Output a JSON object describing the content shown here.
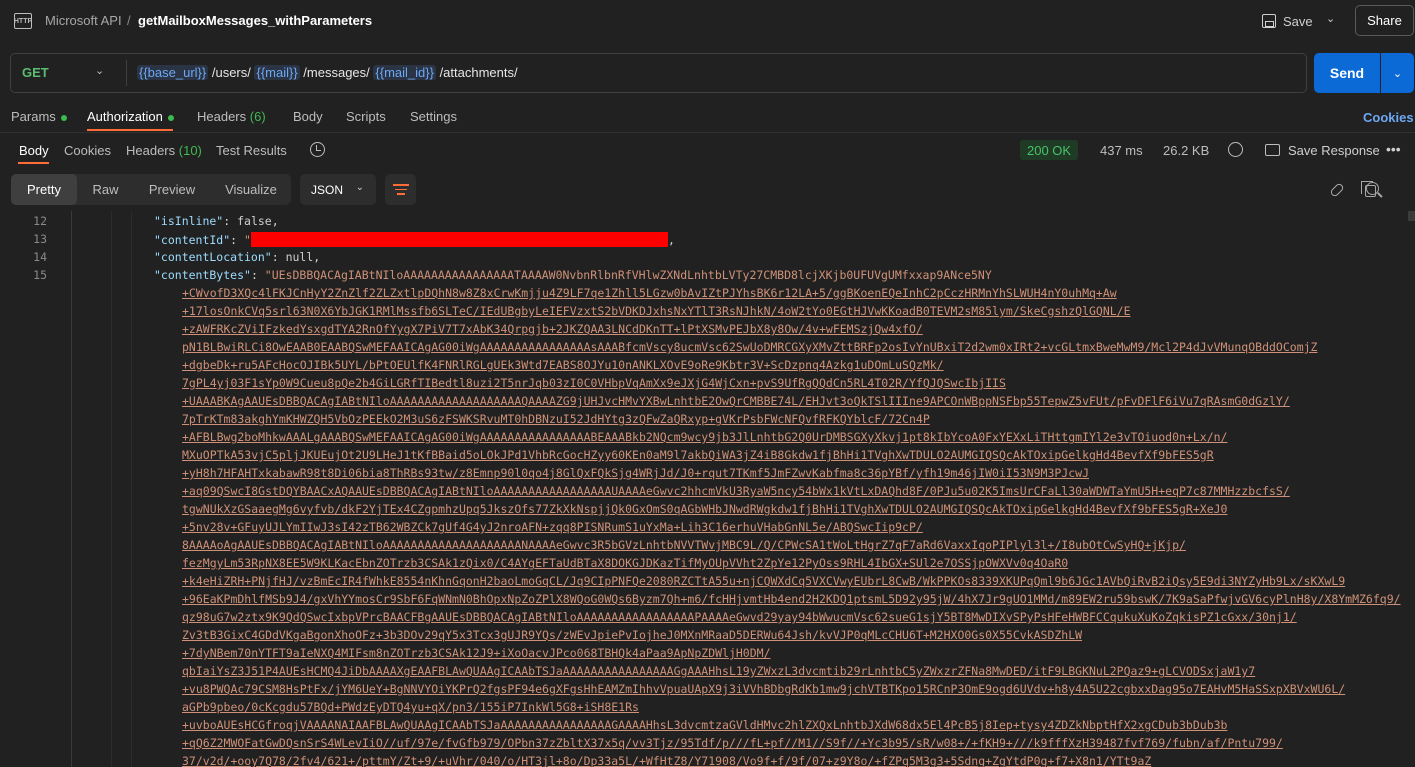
{
  "header": {
    "collection": "Microsoft API",
    "separator": "/",
    "request_name": "getMailboxMessages_withParameters",
    "save_label": "Save",
    "share_label": "Share"
  },
  "url_bar": {
    "method": "GET",
    "segments": [
      {
        "text": "{{base_url}}",
        "is_var": true
      },
      {
        "text": " /users/ ",
        "is_var": false
      },
      {
        "text": "{{mail}}",
        "is_var": true
      },
      {
        "text": " /messages/ ",
        "is_var": false
      },
      {
        "text": "{{mail_id}}",
        "is_var": true
      },
      {
        "text": " /attachments/",
        "is_var": false
      }
    ],
    "send_label": "Send"
  },
  "request_tabs": {
    "params": "Params",
    "authorization": "Authorization",
    "headers": "Headers",
    "headers_count": "(6)",
    "body": "Body",
    "scripts": "Scripts",
    "settings": "Settings",
    "cookies": "Cookies"
  },
  "response_tabs": {
    "body": "Body",
    "cookies": "Cookies",
    "headers": "Headers",
    "headers_count": "(10)",
    "test_results": "Test Results"
  },
  "response_meta": {
    "status": "200 OK",
    "time": "437 ms",
    "size": "26.2 KB",
    "save_response": "Save Response"
  },
  "format_toolbar": {
    "pretty": "Pretty",
    "raw": "Raw",
    "preview": "Preview",
    "visualize": "Visualize",
    "format": "JSON"
  },
  "code": {
    "line_numbers": [
      "12",
      "13",
      "14",
      "15"
    ],
    "line12_key": "\"isInline\"",
    "line12_val": "false",
    "line13_key": "\"contentId\"",
    "line13_open": "\"",
    "line14_key": "\"contentLocation\"",
    "line14_val": "null",
    "line15_key": "\"contentBytes\"",
    "line15_val": "\"UEsDBBQACAgIABtNIloAAAAAAAAAAAAAAAATAAAAW0NvbnRlbnRfVHlwZXNdLnhtbLVTy27CMBD8lcjXKjb0UFUVgUMfxxap9ANce5NY",
    "b64_lines": [
      "+CWvofD3XQc4lFKJCnHyY2ZnZlf2ZLZxtlpDQhN8w8Z8xCrwKmjju4Z9LF7qe1Zhll5LGzw0bAvIZtPJYhsBK6r12LA+5/ggBKoenEQeInhC2pCczHRMnYhSLWUH4nY0uhMq+Aw",
      "+17losOnkCVq5srl63N0X6YbJGK1RMlMssfb6SLTeC/IEdUBgbyLeIEFVzxtS2bVDKDJxhsNxYTlT3RsNJhkN/4oW2tYo0EGtHJVwKKoadB0TEVM2sM85lym/SkeCgshzQlGQNL/E",
      "+zAWFRKcZViIFzkedYsxgdTYA2RnOfYygX7PiV7T7xAbK34Qrpgjb+2JKZQAA3LNCdDKnTT+lPtXSMvPEJbX8y8Ow/4v+wFEMSzjQw4xfO/",
      "pN1BLBwiRLCi8OwEAAB0EAABQSwMEFAAICAgAG00iWgAAAAAAAAAAAAAAAAsAAABfcmVscy8ucmVsc62SwUoDMRCGXyXMvZttBRFp2osIvYnUBxiT2d2wm0xIRt2+vcGLtmxBweMwM9/Mcl2P4dJvVMunqOBddOComjZ",
      "+dgbeDk+ru5AFcHocOJIBk5UYL/bPtOEUlfK4FNRlRGLgUEk3Wtd7EABS8OJYu10nANKLXOvE9oRe9Kbtr3V+ScDzpnq4Azkg1uDOmLuSQzMk/",
      "7gPL4yj03F1sYp0W9Cueu8pQe2b4GiLGRfTIBedtl8uzi2T5nrJqb03zI0C0VHbpVqAmXx9eJXjG4WjCxn+pvS9UfRgQQdCn5RL4T02R/YfQJQSwcIbjIIS",
      "+UAAABKAgAAUEsDBBQACAgIABtNIloAAAAAAAAAAAAAAAAAAAQAAAAZG9jUHJvcHMvYXBwLnhtbE2OwQrCMBBE74L/EHJvt3oQkTSlIIIne9APCOnWBppNSFbp55TepwZ5vFUt/pFvDFlF6iVu7qRAsmG0dGzlY/",
      "7pTrKTm83akghYmKHWZQH5VbOzPEEkO2M3uS6zFSWKSRvuMT0hDBNzuI52JdHYtg3zQFwZaQRxyp+gVKrPsbFWcNFQvfRFKQYblcF/72Cn4P",
      "+AFBLBwg2boMhkwAAALgAAABQSwMEFAAICAgAG00iWgAAAAAAAAAAAAAAAABEAAABkb2NQcm9wcy9jb3JlLnhtbG2Q0UrDMBSGXyXkvj1pt8kIbYcoA0FxYEXxLiTHttgmIYl2e3vTOiuod0n+Lx/n/",
      "MXuOPTkA53vjC5pljJKUEujOt2U9LHeJ1tKfBBaid5oLOkJPd1VhbRcGocHZyy60KEn0aM9l7akbQiWA3jZ4iB8Gkdw1fjBhHi1TVghXwTDULO2AUMGIQSQcAkTOxipGelkgHd4BevfXf9bFES5gR",
      "+yH8h7HFAHTxkabawR98t8Di06bia8ThRBs93tw/z8Emnp90l0qo4j8GlQxFQkSjg4WRjJd/J0+rqut7TKmf5JmFZwvKabfma8c36pYBf/yfh19m46jIW0iI53N9M3PJcwJ",
      "+aq09QSwcI8GstDQYBAACxAQAAUEsDBBQACAgIABtNIloAAAAAAAAAAAAAAAAAUAAAAeGwvc2hhcmVkU3RyaW5ncy54bWx1kVtLxDAQhd8F/0PJu5u02K5ImsUrCFaLl30aWDWTaYmU5H+eqP7c87MMHzzbcfsS/",
      "tgwNUkXzGSaaegMg6vyfvb/dkF2YjTEx4CZgpmhzUpq5JkszOfs77ZkXkNspjjQk0GxOmS0qAGbWHbJNwdRWgkdw1fjBhHi1TVghXwTDULO2AUMGIQSQcAkTOxipGelkgHd4BevfXf9bFES5gR+XeJ0",
      "+5nv28v+GFuyUJLYmIIwJ3sI42zTB62WBZCk7gUf4G4yJ2nroAFN+zqq8PISNRumS1uYxMa+Lih3C16erhuVHabGnNL5e/ABQSwcIip9cP/",
      "8AAAAoAgAAUEsDBBQACAgIABtNIloAAAAAAAAAAAAAAAAAAAANAAAAeGwvc3R5bGVzLnhtbNVVTWvjMBC9L/Q/CPWcSA1tWoLtHgrZ7qF7aRd6VaxxIqoPIPlyl3l+/I8ubOtCwSyHQ+jKjp/",
      "fezMgyLm53RpNX8EE5W9KLKacEbnZOTrzb3CSAk1zQix0/C4AYgEFTaUdBTaX8DOKGJDKazTifMyOUpVVht2ZpYe12PyOss9RHL4IbGX+SUl2e7OSSjpOWXVv0q4OaR0",
      "+k4eHiZRH+PNjfHJ/vzBmEcIR4fWhkE8554nKhnGqonH2baoLmoGqCL/Jq9CIpPNFQe2080RZCTtA55u+njCQWXdCq5VXCVwyEUbrL8CwB/WkPPKOs8339XKUPqQml9b6JGc1AVbQiRvB2iQsy5E9di3NYZyHb9Lx/sKXwL9",
      "+96EaKPmDhlfMSb9J4/gxVhYYmosCr9SbF6FqWNmN0BhOpxNpZoZPlX8WQoG0WQs6Byzm7Qh+m6/fcHHjvmtHb4end2H2KDQ1ptsmL5D92y95jW/4hX7Jr9gUO1MMd/m89EW2ru59bswK/7K9aSaPfwjvGV6cyPlnH8y/X8YmMZ6fq9/",
      "qz98uG7w2ztx9K9QdQSwcIxbpVPrcBAACFBgAAUEsDBBQACAgIABtNIloAAAAAAAAAAAAAAAAAPAAAAeGwvd29yay94bWwucmVsc62sueG1sjY5BT8MwDIXvSPyPsHFeHWBFCCqukuXuKoZqkisPZ1cGxx/30nj1/",
      "Zv3tB3GixC4GDdVKgaBgonXhoOFz+3b3DOv29qY5x3Tcx3gUJR9YQs/zWEvJpiePvIojheJ0MXnMRaaD5DERWu64Jsh/kvVJP0qMLcCHU6T+M2HXO0Gs0X55CvkASDZhLW",
      "+7dyNBem70nYTFT9aIeNXQ4MIFsm8nZOTrzb3CSAk12J9+iXoOacvJPco068TBHQk4aPaa9ApNpZDWljH0DM/",
      "qbIaiYsZ3J51P4AUEsHCMQ4JiDbAAAAXgEAAFBLAwQUAAgICAAbTSJaAAAAAAAAAAAAAAAAGgAAAHhsL19yZWxzL3dvcmtib29rLnhtbC5yZWxzrZFNa8MwDED/itF9LBGKNuL2PQaz9+gLCVODSxjaW1y7",
      "+vu8PWQAc79CSM8HsPtFx/jYM6UeY+BgNNVYOiYKPrQ2fgsPF94e6gXFgsHhEAMZmIhhvVpuaUApX9j3iVVhBDbgRdKb1mw9jchVTBTKpo15RCnP3OmE9ogd6UVdv+h8y4A5U22cgbxxDag95o7EAHvM5HaSSxpXBVxWU6L/",
      "aGPb9pbeo/0cKcgdu57BQd+PWdzEyDTQ4yu+qX/pn3/155iP7InkWl5G8+iSH8E1Rs",
      "+uvboAUEsHCGfroqjVAAAANAIAAFBLAwQUAAgICAAbTSJaAAAAAAAAAAAAAAAAGAAAAHhsL3dvcmtzaGVldHMvc2hlZXQxLnhtbJXdW68dx5El4PcB5j8Iep+tysy4ZDZkNbptHfX2xgCDub3bDub3b",
      "+qQ6Z2MWOFatGwDQsnSrS4WLevIiO//uf/97e/fvGfb979/OPbn37zZbltX37x5q/vv3Tjz/95Tdf/p///fL+pf//M1//S9f//+Yc3b95/sR/w08+/+fKH9+///k9fffXzH39487fvf769/fubn/af/Pntu799/",
      "37/v2d/+ooy7Q78/2fv4/621+/pttmY/Zt+9/+uVhr/040/o/HT3jl+8o/Dp33a5L/+WfHtZ8/Y71908/Vo9f+f/9f/07+z9Y8o/+fZPq5M3g3+5Sdng+ZgYtdP0g+f7+X8n1/YTt9aZ"
    ]
  }
}
